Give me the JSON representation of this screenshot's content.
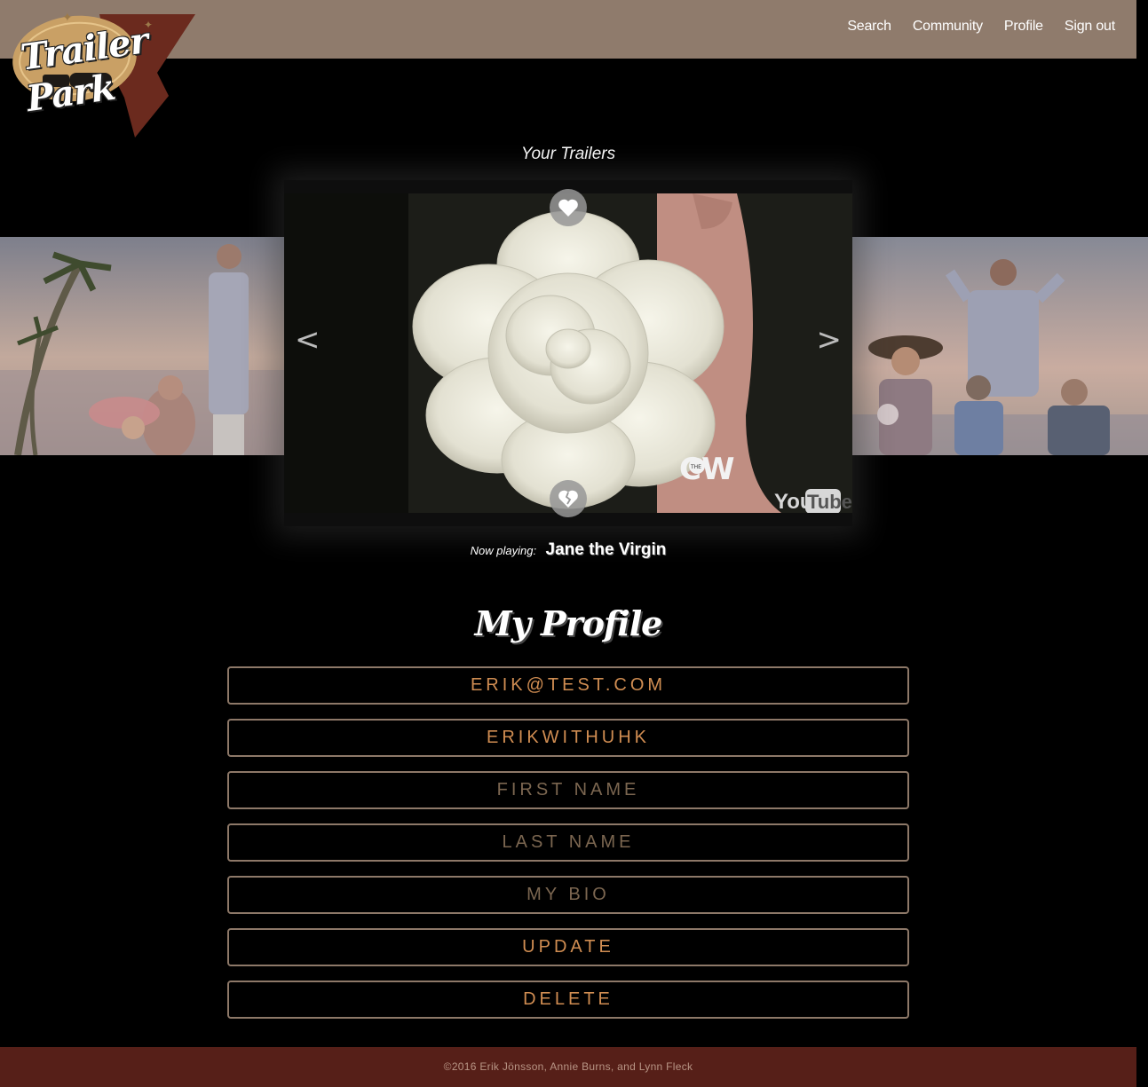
{
  "header": {
    "logo_text": "Trailer Park",
    "nav": [
      "Search",
      "Community",
      "Profile",
      "Sign out"
    ]
  },
  "trailers": {
    "title": "Your Trailers",
    "prev_arrow": "<",
    "next_arrow": ">",
    "video_watermarks": [
      "THE CW",
      "YouTube"
    ],
    "now_playing_label": "Now playing:",
    "now_playing_title": "Jane the Virgin"
  },
  "profile": {
    "title": "My Profile",
    "email_value": "ERIK@TEST.COM",
    "username_value": "ERIKWITHUHK",
    "first_name_placeholder": "FIRST NAME",
    "last_name_placeholder": "LAST NAME",
    "bio_placeholder": "MY BIO",
    "update_label": "UPDATE",
    "delete_label": "DELETE"
  },
  "footer": {
    "text": "©2016 Erik Jönsson, Annie Burns, and Lynn Fleck"
  },
  "colors": {
    "navbar": "#8f7b6c",
    "field_border": "#8d7868",
    "field_text": "#d08d52",
    "footer_bg": "#561f18"
  }
}
